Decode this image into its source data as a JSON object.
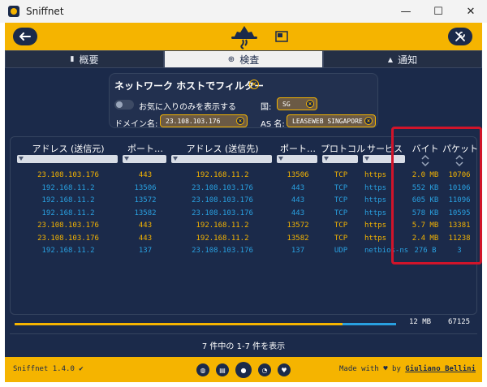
{
  "window": {
    "title": "Sniffnet",
    "minimize": "—",
    "maximize": "☐",
    "close": "✕"
  },
  "header": {
    "back_icon": "arrow-left-icon",
    "settings_icon": "wrench-screwdriver-icon",
    "logo_icon": "spy-hat-logo-icon"
  },
  "tabs": [
    {
      "label": "概要",
      "icon": "bar-chart-icon",
      "glyph": "▮",
      "active": false
    },
    {
      "label": "検査",
      "icon": "magnifier-icon",
      "glyph": "⊕",
      "active": true
    },
    {
      "label": "通知",
      "icon": "bell-icon",
      "glyph": "▲",
      "active": false
    }
  ],
  "filters": {
    "title": "ネットワーク ホストでフィルター",
    "favorites_label": "お気に入りのみを表示する",
    "country_label": "国:",
    "country_value": "SG",
    "domain_label": "ドメイン名:",
    "domain_value": "23.108.103.176",
    "as_label": "AS 名:",
    "as_value": "LEASEWEB SINGAPORE P",
    "clear_glyph": "×"
  },
  "table": {
    "columns": [
      {
        "key": "src",
        "label": "アドレス (送信元)"
      },
      {
        "key": "sport",
        "label": "ポート…"
      },
      {
        "key": "dst",
        "label": "アドレス (送信先)"
      },
      {
        "key": "dport",
        "label": "ポート…"
      },
      {
        "key": "proto",
        "label": "プロトコル"
      },
      {
        "key": "service",
        "label": "サービス"
      },
      {
        "key": "bytes",
        "label": "バイト"
      },
      {
        "key": "packets",
        "label": "パケット"
      }
    ],
    "rows": [
      {
        "src": "23.108.103.176",
        "sport": "443",
        "dst": "192.168.11.2",
        "dport": "13506",
        "proto": "TCP",
        "service": "https",
        "bytes": "2.0 MB",
        "packets": "10706",
        "direction": "in"
      },
      {
        "src": "192.168.11.2",
        "sport": "13506",
        "dst": "23.108.103.176",
        "dport": "443",
        "proto": "TCP",
        "service": "https",
        "bytes": "552 KB",
        "packets": "10106",
        "direction": "out"
      },
      {
        "src": "192.168.11.2",
        "sport": "13572",
        "dst": "23.108.103.176",
        "dport": "443",
        "proto": "TCP",
        "service": "https",
        "bytes": "605 KB",
        "packets": "11096",
        "direction": "out"
      },
      {
        "src": "192.168.11.2",
        "sport": "13582",
        "dst": "23.108.103.176",
        "dport": "443",
        "proto": "TCP",
        "service": "https",
        "bytes": "578 KB",
        "packets": "10595",
        "direction": "out"
      },
      {
        "src": "23.108.103.176",
        "sport": "443",
        "dst": "192.168.11.2",
        "dport": "13572",
        "proto": "TCP",
        "service": "https",
        "bytes": "5.7 MB",
        "packets": "13381",
        "direction": "in"
      },
      {
        "src": "23.108.103.176",
        "sport": "443",
        "dst": "192.168.11.2",
        "dport": "13582",
        "proto": "TCP",
        "service": "https",
        "bytes": "2.4 MB",
        "packets": "11238",
        "direction": "in"
      },
      {
        "src": "192.168.11.2",
        "sport": "137",
        "dst": "23.108.103.176",
        "dport": "137",
        "proto": "UDP",
        "service": "netbios-ns",
        "bytes": "276 B",
        "packets": "3",
        "direction": "out"
      }
    ]
  },
  "totals": {
    "bytes": "12 MB",
    "packets": "67125",
    "incoming_fraction": 0.86
  },
  "results_text": "7 件中の 1-7 件を表示",
  "footer": {
    "version": "Sniffnet 1.4.0",
    "version_check": "✔",
    "icons": [
      "globe-icon",
      "book-icon",
      "github-icon",
      "rss-icon",
      "heart-icon"
    ],
    "made_with": "Made with",
    "heart": "♥",
    "by": "by",
    "author": "Giuliano Bellini"
  },
  "colors": {
    "accent": "#f5b400",
    "background": "#1b2a4a",
    "incoming": "#f5b400",
    "outgoing": "#29a0e0",
    "highlight": "#d1142a"
  }
}
